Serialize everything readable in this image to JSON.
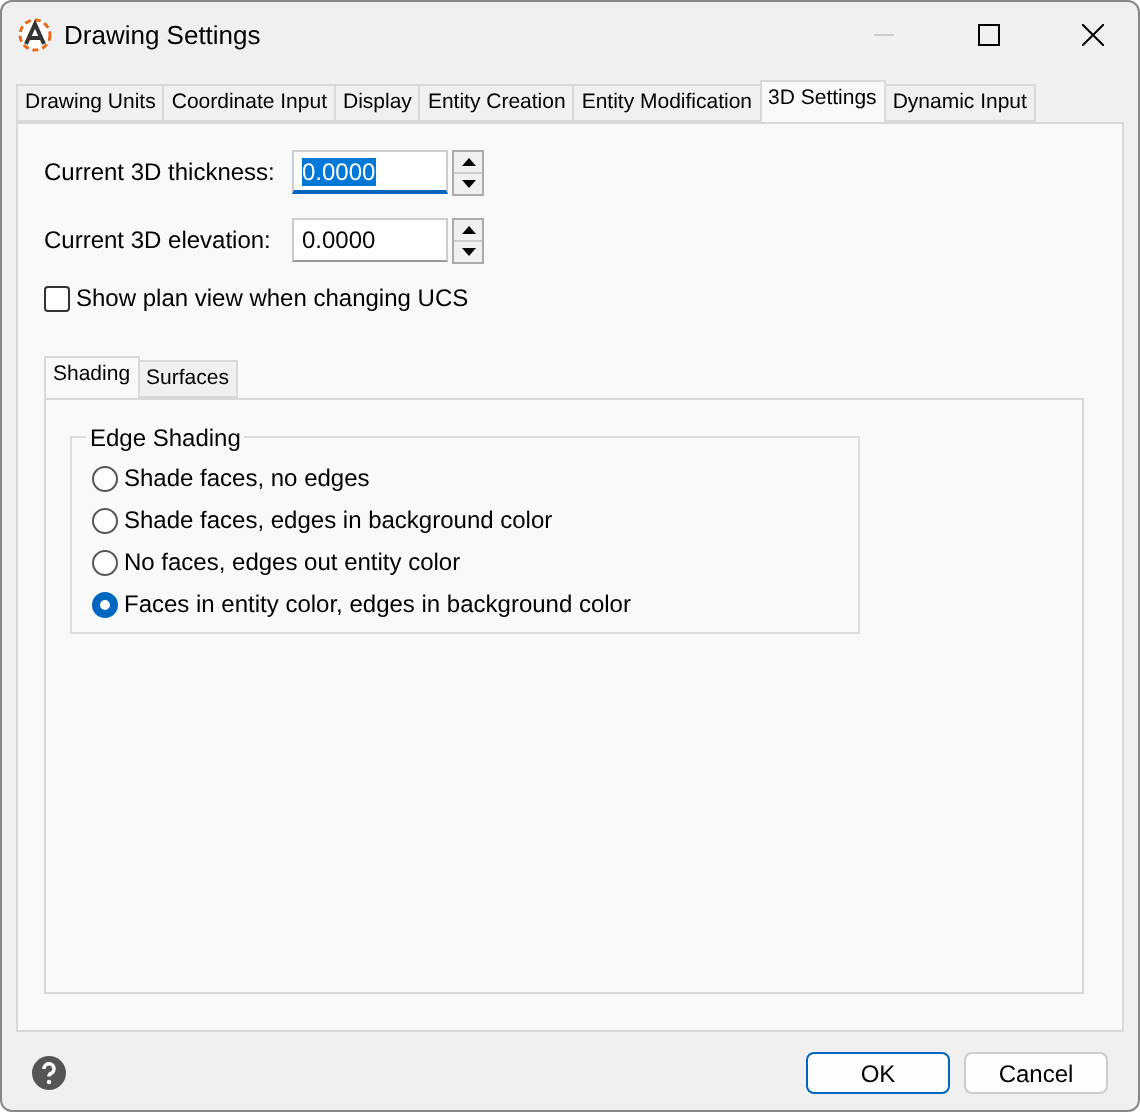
{
  "window": {
    "title": "Drawing Settings"
  },
  "tabs": [
    {
      "label": "Drawing Units",
      "selected": false
    },
    {
      "label": "Coordinate Input",
      "selected": false
    },
    {
      "label": "Display",
      "selected": false
    },
    {
      "label": "Entity Creation",
      "selected": false
    },
    {
      "label": "Entity Modification",
      "selected": false
    },
    {
      "label": "3D Settings",
      "selected": true
    },
    {
      "label": "Dynamic Input",
      "selected": false
    }
  ],
  "fields": [
    {
      "label": "Current 3D thickness:",
      "value": "0.0000",
      "focused": true
    },
    {
      "label": "Current 3D elevation:",
      "value": "0.0000",
      "focused": false
    }
  ],
  "checkbox": {
    "label": "Show plan view when changing UCS",
    "checked": false
  },
  "subtabs": [
    {
      "label": "Shading",
      "selected": true
    },
    {
      "label": "Surfaces",
      "selected": false
    }
  ],
  "group": {
    "title": "Edge Shading",
    "options": [
      {
        "label": "Shade faces, no edges",
        "selected": false
      },
      {
        "label": "Shade faces, edges in background color",
        "selected": false
      },
      {
        "label": "No faces, edges out entity color",
        "selected": false
      },
      {
        "label": "Faces in entity color, edges in background color",
        "selected": true
      }
    ]
  },
  "buttons": [
    {
      "label": "OK",
      "default": true
    },
    {
      "label": "Cancel",
      "default": false
    }
  ]
}
